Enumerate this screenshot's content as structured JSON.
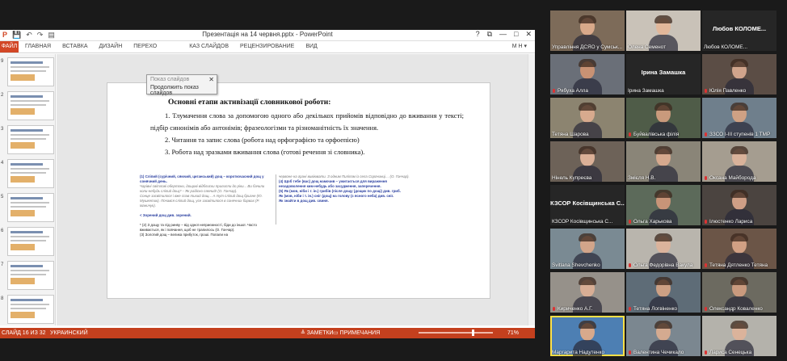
{
  "window": {
    "title": "Презентація на 14 червня.pptx - PowerPoint",
    "controls": [
      "?",
      "⧉",
      "—",
      "□",
      "✕"
    ]
  },
  "qat": [
    "P",
    "💾",
    "↶",
    "↷",
    "▤"
  ],
  "ribbon": {
    "file_tab": "ФАЙЛ",
    "tabs": [
      "ГЛАВНАЯ",
      "ВСТАВКА",
      "ДИЗАЙН",
      "ПЕРЕХО",
      "КАЗ СЛАЙДОВ",
      "РЕЦЕНЗИРОВАНИЕ",
      "ВИД"
    ],
    "user": "М Н ▾"
  },
  "slideshow_popup": {
    "line1": "Показ слайдов",
    "line2": "Продолжить показ слайдов",
    "close": "✕"
  },
  "thumbnails": {
    "numbers": [
      "9",
      "2",
      "3",
      "4",
      "5",
      "6",
      "7",
      "8",
      "9"
    ],
    "selected_index": 8
  },
  "slide": {
    "heading": "Основні етапи активізації словникової роботи:",
    "p1": "1. Тлумачення слова за допомогою одного або декількох прийомів відповідно до вживання у тексті; підбір синонімів або антонімів; фразеологізми та різноманітність їх значення.",
    "p2": "2. Читання та запис слова (робота над орфографією та орфоепією)",
    "p3": "3. Робота над зразками вживання слова (готові речення зі словника).",
    "clip_left": {
      "line1": "(1) Сліпий (сурічний, сяючий, циганський) дощ – короткочасний дощ у сонячний день.",
      "line1_muted": "Чарівні світлові обертони, дощові відблиски прилипли до ріки... Ви бачили коли-небудь сліпий дощ? – Як радісно сяючий! (О. Гончар).",
      "line2": "Сонце засвітилося і вже спав тихий дощ... А тут сліпий дощ бризне (Ю. Мушкетик). Почався сліпий дощ, усе засвітилося в сонячних барвах (Р. Іваничук).",
      "line3": "< Зорений дощ див. зорений.",
      "line4": "* (2) З дощу та під ринву – від одної неприємності, біди до іншої. Часто вживається, як і повчання, щоб не трапилось (О. Гончар).",
      "line5": "(3) Золотий дощ – велика прибуток, гроші. Попали на"
    },
    "clip_right": {
      "line1_muted": "червоне на грані вивіювати. З одним Пиліпом із села Сорочинці… (О. Гончар).",
      "line2": "(4) Щоб тебе (вас) дощ намочив – ужитається для вираження незадоволення ким-небудь або засудження, заперечення.",
      "line3": "(5) Як (мов, ніби і т. ін.) грибів (після дощу (дощик по дощі) див. гриб.",
      "line4": "Як (мов, ніби і т. ін.) сніг (дощ) на голову (з ясного неба) див. сніг.",
      "line5": "Як знайти в дощ див. свиня."
    }
  },
  "statusbar": {
    "slide_info": "СЛАЙД 16 ИЗ 32",
    "language": "УКРАИНСКИЙ",
    "notes": "≜ ЗАМЕТКИ",
    "comments": "▭ ПРИМЕЧАНИЯ",
    "zoom": "71%"
  },
  "participants": [
    {
      "name": "Управління ДСЯО у Сумськ...",
      "mic": false,
      "video": true,
      "bg": "#7d6b59",
      "face": "#d9a98a"
    },
    {
      "name": "Олена Семенот",
      "mic": false,
      "video": true,
      "bg": "#c9c2b8",
      "face": "#e2b79a"
    },
    {
      "name": "Любов КОЛОМЕ...",
      "mic": false,
      "video": false,
      "bg": "#262626",
      "face": ""
    },
    {
      "name": "Рябуха Алла",
      "mic": true,
      "video": true,
      "bg": "#6a6f78",
      "face": "#c89274"
    },
    {
      "name": "Ірина Замашка",
      "mic": false,
      "video": false,
      "bg": "#262626",
      "face": ""
    },
    {
      "name": "Юлія Павленко",
      "mic": true,
      "video": true,
      "bg": "#5b4d45",
      "face": "#d0a48c"
    },
    {
      "name": "Тетяна Шарова",
      "mic": false,
      "video": true,
      "bg": "#8c8470",
      "face": "#d8aa8e"
    },
    {
      "name": "Буйвалівська філія",
      "mic": true,
      "video": true,
      "bg": "#4f5c48",
      "face": "#c99a7c"
    },
    {
      "name": "ЗЗСО І-ІІІ ступенів 1 ТМР",
      "mic": true,
      "video": true,
      "bg": "#6f7f8c",
      "face": "#cfa184"
    },
    {
      "name": "Нінель Купреєва",
      "mic": false,
      "video": true,
      "bg": "#6d6258",
      "face": "#dbb097"
    },
    {
      "name": "Змієля Н.В.",
      "mic": false,
      "video": true,
      "bg": "#8a8578",
      "face": "#d6a98e"
    },
    {
      "name": "Оксана Майборода",
      "mic": true,
      "video": true,
      "bg": "#a59d90",
      "face": "#d9b29a"
    },
    {
      "name": "КЗСОР Косівщинська С...",
      "mic": false,
      "video": false,
      "bg": "#262626",
      "face": ""
    },
    {
      "name": "Ольга Харькова",
      "mic": true,
      "video": true,
      "bg": "#5c6a5a",
      "face": "#c89478"
    },
    {
      "name": "Ілюстенко Лариса",
      "mic": true,
      "video": true,
      "bg": "#4b4440",
      "face": "#cf9f86"
    },
    {
      "name": "Svitlana Shevchenko",
      "mic": false,
      "video": true,
      "bg": "#7a8a93",
      "face": "#d2a58a"
    },
    {
      "name": "Ольга Федорівна Вакула",
      "mic": true,
      "video": true,
      "bg": "#b9b5ad",
      "face": "#dbb39c"
    },
    {
      "name": "Тетяна Дятленко Тетяна",
      "mic": true,
      "video": true,
      "bg": "#6b5547",
      "face": "#d1a084"
    },
    {
      "name": "Кириченко А.Г.",
      "mic": true,
      "video": true,
      "bg": "#96918a",
      "face": "#d8ae95"
    },
    {
      "name": "Тетяна Логвіненко",
      "mic": true,
      "video": true,
      "bg": "#5e6c77",
      "face": "#cda084"
    },
    {
      "name": "Олександр Коваленко",
      "mic": true,
      "video": true,
      "bg": "#6c6a60",
      "face": "#c99a7e"
    },
    {
      "name": "Маргарита Надутенко",
      "mic": false,
      "video": true,
      "bg": "#4d7fb3",
      "face": "#d7a98c",
      "active": true
    },
    {
      "name": "Валентина Чечикало",
      "mic": true,
      "video": true,
      "bg": "#7b8790",
      "face": "#d4aa90"
    },
    {
      "name": "Лариса Сенецька",
      "mic": true,
      "video": true,
      "bg": "#b4b2ab",
      "face": "#dbb39b"
    }
  ],
  "colors": {
    "ppt_accent": "#d24726",
    "status_bar": "#c4401e",
    "active_speaker": "#fde047"
  }
}
